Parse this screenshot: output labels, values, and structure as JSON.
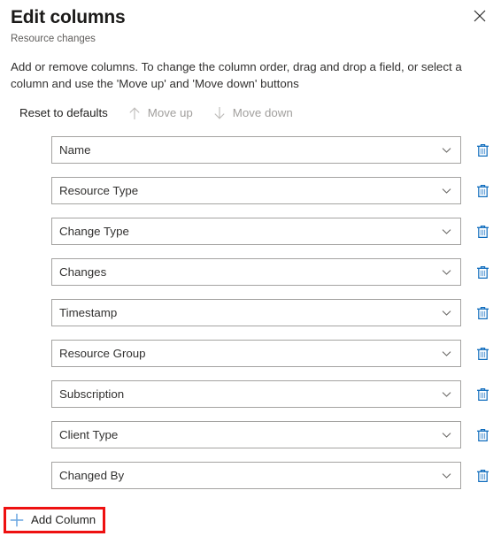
{
  "panel": {
    "title": "Edit columns",
    "subtitle": "Resource changes",
    "close_label": "Close",
    "close_icon": "close-icon",
    "description": "Add or remove columns. To change the column order, drag and drop a field, or select a column and use the 'Move up' and 'Move down' buttons"
  },
  "command_bar": {
    "items": [
      {
        "label": "Reset to defaults",
        "icon": "",
        "disabled": false
      },
      {
        "label": "Move up",
        "icon": "arrow-up-icon",
        "disabled": true
      },
      {
        "label": "Move down",
        "icon": "arrow-down-icon",
        "disabled": true
      }
    ]
  },
  "columns": {
    "chevron_icon": "chevron-down-icon",
    "delete_icon": "trash-icon",
    "items": [
      {
        "label": "Name"
      },
      {
        "label": "Resource Type"
      },
      {
        "label": "Change Type"
      },
      {
        "label": "Changes"
      },
      {
        "label": "Timestamp"
      },
      {
        "label": "Resource Group"
      },
      {
        "label": "Subscription"
      },
      {
        "label": "Client Type"
      },
      {
        "label": "Changed By"
      }
    ]
  },
  "add_column": {
    "label": "Add Column",
    "icon": "plus-icon",
    "highlighted": true
  },
  "colors": {
    "accent": "#0078d4",
    "highlight_box": "#ee1111",
    "text_primary": "#323130",
    "text_secondary": "#605e5c",
    "text_disabled": "#a19f9d",
    "field_border": "#a4a3a1",
    "background": "#ffffff"
  }
}
